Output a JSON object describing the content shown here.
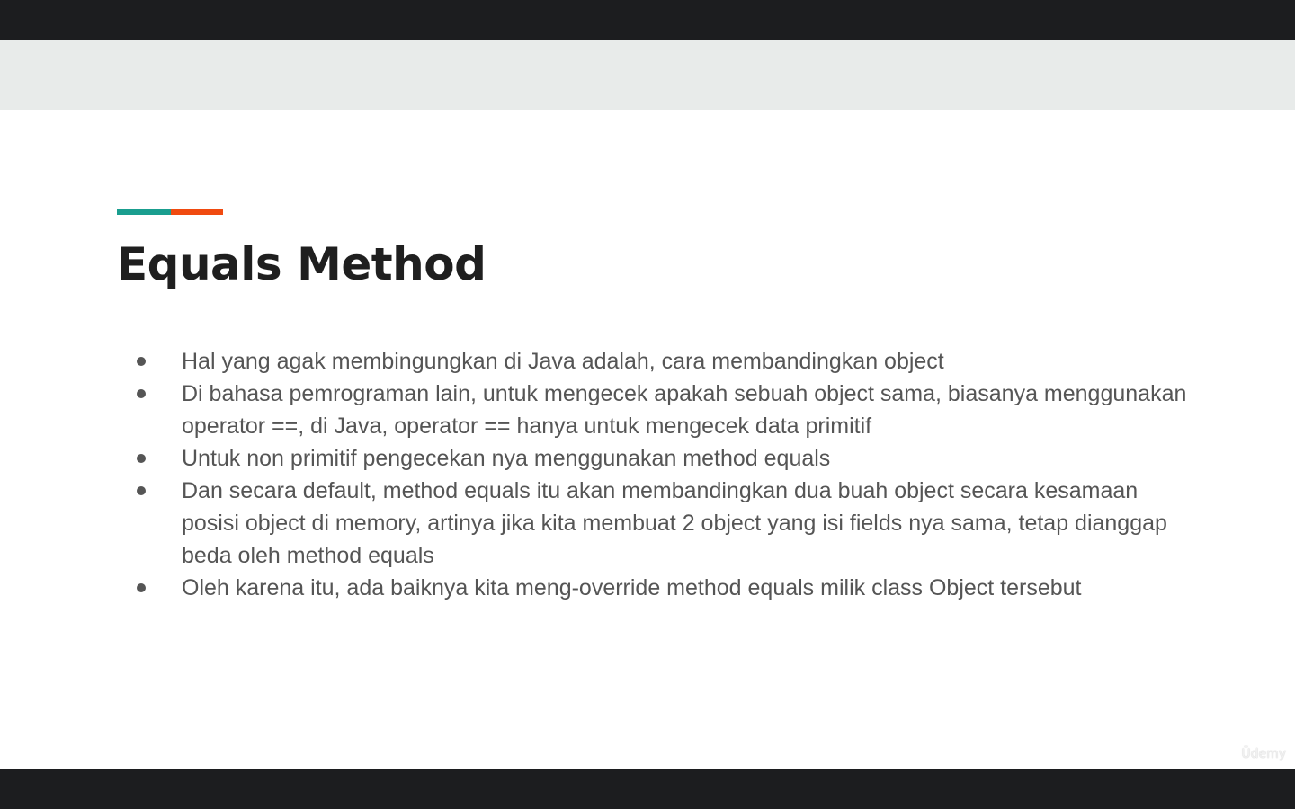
{
  "slide": {
    "title": "Equals Method",
    "bullets": [
      "Hal yang agak membingungkan di Java adalah, cara membandingkan object",
      "Di bahasa pemrograman lain, untuk mengecek apakah sebuah object sama, biasanya menggunakan operator ==, di Java, operator == hanya untuk mengecek data primitif",
      "Untuk non primitif pengecekan nya menggunakan method equals",
      "Dan secara default, method equals itu akan membandingkan dua buah object secara kesamaan posisi object di memory, artinya jika kita membuat 2 object yang isi fields nya sama, tetap dianggap beda oleh method equals",
      "Oleh karena itu, ada baiknya kita meng-override method equals milik class Object tersebut"
    ],
    "watermark": "Ūdemy"
  },
  "colors": {
    "accent_teal": "#1a9e8f",
    "accent_orange": "#f04a10",
    "header_band": "#e8ebea",
    "title": "#1f1f1f",
    "body_text": "#555555"
  }
}
